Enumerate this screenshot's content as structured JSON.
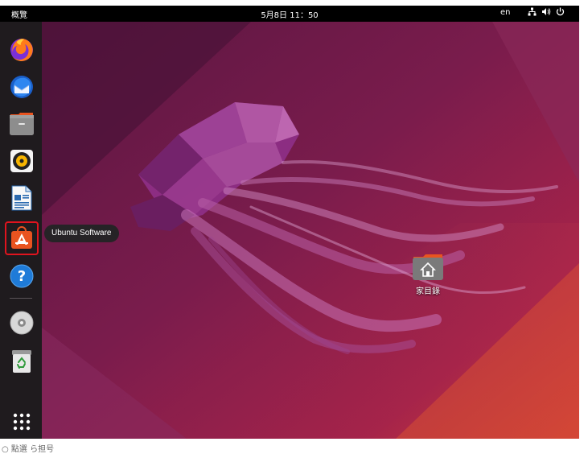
{
  "topbar": {
    "activities_label": "概覽",
    "clock": "5月8日 11：50",
    "language": "en",
    "tray_icons": [
      "network-icon",
      "volume-icon",
      "power-icon"
    ]
  },
  "dock": {
    "items": [
      {
        "name": "firefox",
        "icon": "firefox-icon"
      },
      {
        "name": "thunderbird",
        "icon": "thunderbird-icon"
      },
      {
        "name": "files",
        "icon": "files-icon"
      },
      {
        "name": "rhythmbox",
        "icon": "rhythmbox-icon"
      },
      {
        "name": "libreoffice-writer",
        "icon": "writer-icon"
      },
      {
        "name": "ubuntu-software",
        "icon": "software-icon",
        "highlighted": true
      },
      {
        "name": "help",
        "icon": "help-icon"
      },
      {
        "name": "dvd",
        "icon": "disc-icon"
      },
      {
        "name": "trash",
        "icon": "trash-icon"
      },
      {
        "name": "show-apps",
        "icon": "app-grid-icon"
      }
    ]
  },
  "tooltip": {
    "text": "Ubuntu Software"
  },
  "desktop": {
    "home_label": "家目錄"
  },
  "caption": "○ 點選 ら担号",
  "colors": {
    "highlight": "#e0141e",
    "ubuntu_orange": "#e95420",
    "wallpaper_dark": "#2c0a1f"
  }
}
